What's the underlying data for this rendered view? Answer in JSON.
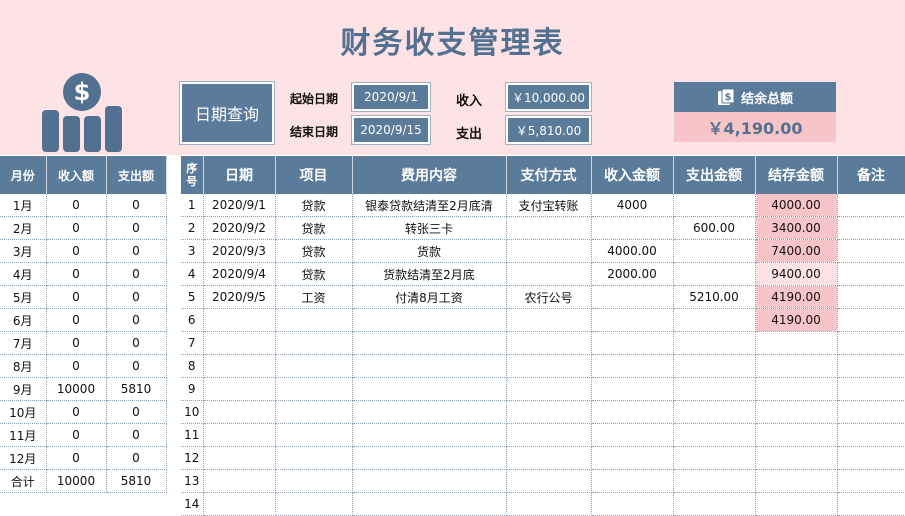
{
  "title": "财务收支管理表",
  "query": {
    "button_label": "日期查询",
    "start_label": "起始日期",
    "start_value": "2020/9/1",
    "end_label": "结束日期",
    "end_value": "2020/9/15",
    "income_label": "收入",
    "income_value": "￥10,000.00",
    "expense_label": "支出",
    "expense_value": "￥5,810.00"
  },
  "balance": {
    "label": "结余总额",
    "value": "￥4,190.00"
  },
  "monthly": {
    "headers": [
      "月份",
      "收入额",
      "支出额"
    ],
    "rows": [
      [
        "1月",
        "0",
        "0"
      ],
      [
        "2月",
        "0",
        "0"
      ],
      [
        "3月",
        "0",
        "0"
      ],
      [
        "4月",
        "0",
        "0"
      ],
      [
        "5月",
        "0",
        "0"
      ],
      [
        "6月",
        "0",
        "0"
      ],
      [
        "7月",
        "0",
        "0"
      ],
      [
        "8月",
        "0",
        "0"
      ],
      [
        "9月",
        "10000",
        "5810"
      ],
      [
        "10月",
        "0",
        "0"
      ],
      [
        "11月",
        "0",
        "0"
      ],
      [
        "12月",
        "0",
        "0"
      ],
      [
        "合计",
        "10000",
        "5810"
      ]
    ]
  },
  "ledger": {
    "headers": [
      "序号",
      "日期",
      "项目",
      "费用内容",
      "支付方式",
      "收入金额",
      "支出金额",
      "结存金额",
      "备注"
    ],
    "rows": [
      [
        "1",
        "2020/9/1",
        "贷款",
        "银泰贷款结清至2月底清",
        "支付宝转账",
        "4000",
        "",
        "4000.00",
        ""
      ],
      [
        "2",
        "2020/9/2",
        "贷款",
        "转张三卡",
        "",
        "",
        "600.00",
        "3400.00",
        ""
      ],
      [
        "3",
        "2020/9/3",
        "贷款",
        "货款",
        "",
        "4000.00",
        "",
        "7400.00",
        ""
      ],
      [
        "4",
        "2020/9/4",
        "贷款",
        "货款结清至2月底",
        "",
        "2000.00",
        "",
        "9400.00",
        ""
      ],
      [
        "5",
        "2020/9/5",
        "工资",
        "付清8月工资",
        "农行公号",
        "",
        "5210.00",
        "4190.00",
        ""
      ],
      [
        "6",
        "",
        "",
        "",
        "",
        "",
        "",
        "4190.00",
        ""
      ],
      [
        "7",
        "",
        "",
        "",
        "",
        "",
        "",
        "",
        ""
      ],
      [
        "8",
        "",
        "",
        "",
        "",
        "",
        "",
        "",
        ""
      ],
      [
        "9",
        "",
        "",
        "",
        "",
        "",
        "",
        "",
        ""
      ],
      [
        "10",
        "",
        "",
        "",
        "",
        "",
        "",
        "",
        ""
      ],
      [
        "11",
        "",
        "",
        "",
        "",
        "",
        "",
        "",
        ""
      ],
      [
        "12",
        "",
        "",
        "",
        "",
        "",
        "",
        "",
        ""
      ],
      [
        "13",
        "",
        "",
        "",
        "",
        "",
        "",
        "",
        ""
      ],
      [
        "14",
        "",
        "",
        "",
        "",
        "",
        "",
        "",
        ""
      ]
    ]
  },
  "colors": {
    "accent": "#5a7b99",
    "header_bg": "#fde3e5",
    "highlight": "#f7c4c8",
    "title": "#52708f"
  },
  "icons": {
    "logo": "money-chart-icon",
    "balance": "wallet-icon"
  }
}
